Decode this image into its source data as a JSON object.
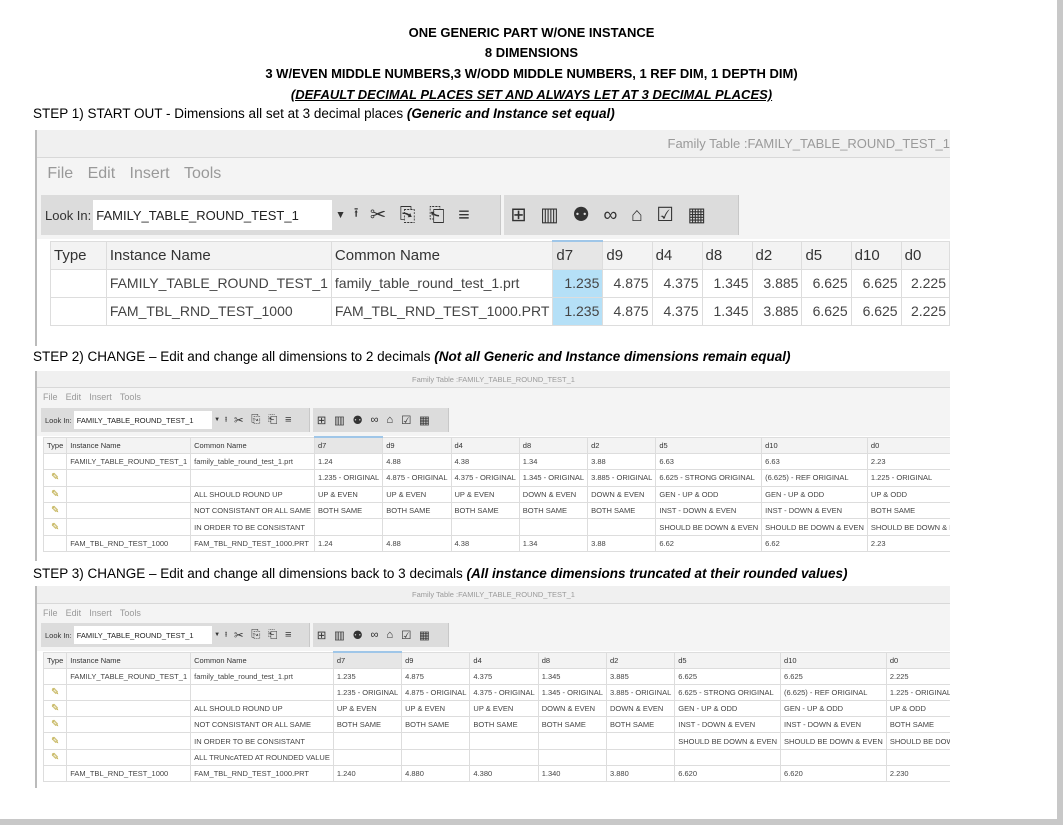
{
  "header": {
    "line1": "ONE GENERIC PART W/ONE INSTANCE",
    "line2": "8 DIMENSIONS",
    "line3": "3 W/EVEN MIDDLE NUMBERS,3 W/ODD MIDDLE NUMBERS, 1 REF DIM, 1 DEPTH DIM)",
    "line4": "(DEFAULT DECIMAL PLACES SET AND ALWAYS LET AT 3 DECIMAL PLACES)"
  },
  "steps": [
    {
      "text": "STEP 1) START OUT - Dimensions all set at 3 decimal places ",
      "note": "(Generic and Instance set equal)"
    },
    {
      "text": "STEP 2) CHANGE – Edit and change all dimensions to 2 decimals ",
      "note": "(Not all Generic and Instance dimensions remain equal)"
    },
    {
      "text": "STEP 3) CHANGE – Edit and change all dimensions back to 3 decimals ",
      "note": "(All instance dimensions truncated at their rounded values)"
    }
  ],
  "window": {
    "title": "Family Table :FAMILY_TABLE_ROUND_TEST_1",
    "menu": [
      "File",
      "Edit",
      "Insert",
      "Tools"
    ],
    "look_in_label": "Look In:",
    "look_in_value": "FAMILY_TABLE_ROUND_TEST_1",
    "dropdown": "▼"
  },
  "toolbar_icons": [
    "folder-up-icon",
    "cut-icon",
    "copy-icon",
    "paste-icon",
    "add-column-icon",
    "insert-item-icon",
    "column-icon",
    "binoculars-find-icon",
    "glasses-preview-icon",
    "lock-icon",
    "verify-icon",
    "table-properties-icon"
  ],
  "columns": [
    "Type",
    "Instance Name",
    "Common Name",
    "d7",
    "d9",
    "d4",
    "d8",
    "d2",
    "d5",
    "d10",
    "d0"
  ],
  "tables": [
    {
      "rows": [
        {
          "type": "",
          "cells": [
            "FAMILY_TABLE_ROUND_TEST_1",
            "family_table_round_test_1.prt",
            "1.235",
            "4.875",
            "4.375",
            "1.345",
            "3.885",
            "6.625",
            "6.625",
            "2.225"
          ]
        },
        {
          "type": "",
          "cells": [
            "FAM_TBL_RND_TEST_1000",
            "FAM_TBL_RND_TEST_1000.PRT",
            "1.235",
            "4.875",
            "4.375",
            "1.345",
            "3.885",
            "6.625",
            "6.625",
            "2.225"
          ]
        }
      ]
    },
    {
      "rows": [
        {
          "type": "",
          "cells": [
            "FAMILY_TABLE_ROUND_TEST_1",
            "family_table_round_test_1.prt",
            "1.24",
            "4.88",
            "4.38",
            "1.34",
            "3.88",
            "6.63",
            "6.63",
            "2.23"
          ]
        },
        {
          "type": "edit-icon",
          "cells": [
            "",
            "",
            "1.235 - ORIGINAL",
            "4.875 - ORIGINAL",
            "4.375 - ORIGINAL",
            "1.345 - ORIGINAL",
            "3.885 - ORIGINAL",
            "6.625 - STRONG ORIGINAL",
            "(6.625) - REF ORIGINAL",
            "1.225 - ORIGINAL"
          ]
        },
        {
          "type": "edit-icon",
          "cells": [
            "",
            "ALL SHOULD ROUND UP",
            "UP & EVEN",
            "UP & EVEN",
            "UP & EVEN",
            "DOWN & EVEN",
            "DOWN & EVEN",
            "GEN - UP & ODD",
            "GEN - UP & ODD",
            "UP & ODD"
          ]
        },
        {
          "type": "edit-icon",
          "cells": [
            "",
            "NOT CONSISTANT OR ALL SAME",
            "BOTH SAME",
            "BOTH SAME",
            "BOTH SAME",
            "BOTH SAME",
            "BOTH SAME",
            "INST - DOWN & EVEN",
            "INST - DOWN & EVEN",
            "BOTH SAME"
          ]
        },
        {
          "type": "edit-icon",
          "cells": [
            "",
            "IN ORDER TO BE CONSISTANT",
            "",
            "",
            "",
            "",
            "",
            "SHOULD BE DOWN & EVEN",
            "SHOULD BE DOWN & EVEN",
            "SHOULD BE DOWN & EVEN"
          ]
        },
        {
          "type": "",
          "cells": [
            "FAM_TBL_RND_TEST_1000",
            "FAM_TBL_RND_TEST_1000.PRT",
            "1.24",
            "4.88",
            "4.38",
            "1.34",
            "3.88",
            "6.62",
            "6.62",
            "2.23"
          ]
        }
      ]
    },
    {
      "rows": [
        {
          "type": "",
          "cells": [
            "FAMILY_TABLE_ROUND_TEST_1",
            "family_table_round_test_1.prt",
            "1.235",
            "4.875",
            "4.375",
            "1.345",
            "3.885",
            "6.625",
            "6.625",
            "2.225"
          ]
        },
        {
          "type": "edit-icon",
          "cells": [
            "",
            "",
            "1.235 - ORIGINAL",
            "4.875 - ORIGINAL",
            "4.375 - ORIGINAL",
            "1.345 - ORIGINAL",
            "3.885 - ORIGINAL",
            "6.625 - STRONG ORIGINAL",
            "(6.625) - REF ORIGINAL",
            "1.225 - ORIGINAL"
          ]
        },
        {
          "type": "edit-icon",
          "cells": [
            "",
            "ALL SHOULD ROUND UP",
            "UP & EVEN",
            "UP & EVEN",
            "UP & EVEN",
            "DOWN & EVEN",
            "DOWN & EVEN",
            "GEN - UP & ODD",
            "GEN - UP & ODD",
            "UP & ODD"
          ]
        },
        {
          "type": "edit-icon",
          "cells": [
            "",
            "NOT CONSISTANT OR ALL SAME",
            "BOTH SAME",
            "BOTH SAME",
            "BOTH SAME",
            "BOTH SAME",
            "BOTH SAME",
            "INST - DOWN & EVEN",
            "INST - DOWN & EVEN",
            "BOTH SAME"
          ]
        },
        {
          "type": "edit-icon",
          "cells": [
            "",
            "IN ORDER TO BE CONSISTANT",
            "",
            "",
            "",
            "",
            "",
            "SHOULD BE DOWN & EVEN",
            "SHOULD BE DOWN & EVEN",
            "SHOULD BE DOWN & EVEN"
          ]
        },
        {
          "type": "edit-icon",
          "cells": [
            "",
            "ALL TRUNcATED AT ROUNDED VALUE",
            "",
            "",
            "",
            "",
            "",
            "",
            "",
            ""
          ]
        },
        {
          "type": "",
          "cells": [
            "FAM_TBL_RND_TEST_1000",
            "FAM_TBL_RND_TEST_1000.PRT",
            "1.240",
            "4.880",
            "4.380",
            "1.340",
            "3.880",
            "6.620",
            "6.620",
            "2.230"
          ]
        }
      ]
    }
  ]
}
